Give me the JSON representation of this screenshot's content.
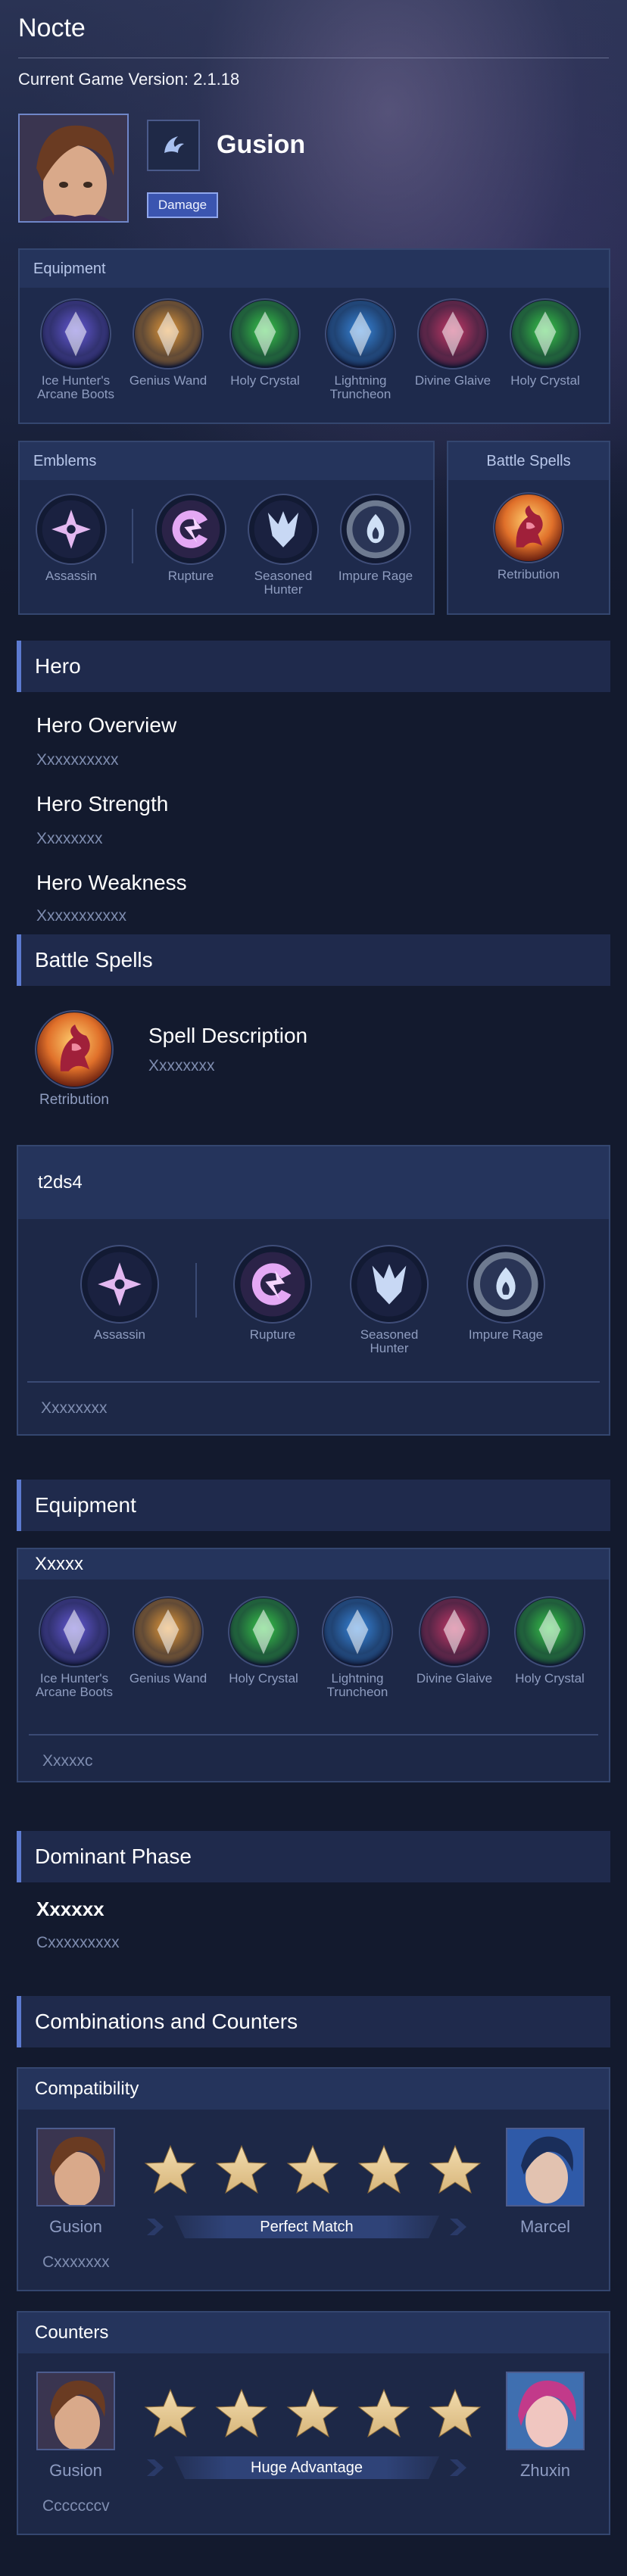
{
  "app": {
    "title": "Nocte",
    "version": "Current Game Version: 2.1.18"
  },
  "hero": {
    "name": "Gusion",
    "role": "Damage",
    "portrait_icon": "gusion-portrait",
    "role_icon": "assassin-role-icon"
  },
  "equipment_panel": {
    "title": "Equipment",
    "items": [
      {
        "label": "Ice Hunter's Arcane Boots",
        "icon": "boots-icon",
        "color": "#6a5de0"
      },
      {
        "label": "Genius Wand",
        "icon": "wand-icon",
        "color": "#f2a23a"
      },
      {
        "label": "Holy Crystal",
        "icon": "crystal-icon",
        "color": "#39d34a"
      },
      {
        "label": "Lightning Truncheon",
        "icon": "truncheon-icon",
        "color": "#3a8ee8"
      },
      {
        "label": "Divine Glaive",
        "icon": "glaive-icon",
        "color": "#d03a6a"
      },
      {
        "label": "Holy Crystal",
        "icon": "crystal-icon",
        "color": "#39d34a"
      }
    ]
  },
  "emblems_panel": {
    "title": "Emblems",
    "items": [
      {
        "label": "Assassin",
        "icon": "assassin-emblem-icon"
      },
      {
        "label": "Rupture",
        "icon": "rupture-icon"
      },
      {
        "label": "Seasoned Hunter",
        "icon": "seasoned-hunter-icon"
      },
      {
        "label": "Impure Rage",
        "icon": "impure-rage-icon"
      }
    ]
  },
  "battle_spells_panel": {
    "title": "Battle Spells",
    "spell": {
      "label": "Retribution",
      "icon": "retribution-icon"
    }
  },
  "hero_section": {
    "heading": "Hero",
    "overview_title": "Hero Overview",
    "overview_text": "Xxxxxxxxxx",
    "strength_title": "Hero Strength",
    "strength_text": "Xxxxxxxx",
    "weakness_title": "Hero Weakness",
    "weakness_text": "Xxxxxxxxxxx"
  },
  "battle_spells_section": {
    "heading": "Battle Spells",
    "spell_label": "Retribution",
    "desc_title": "Spell Description",
    "desc_text": "Xxxxxxxx"
  },
  "emblem_build": {
    "title": "t2ds4",
    "items": [
      {
        "label": "Assassin",
        "icon": "assassin-emblem-icon"
      },
      {
        "label": "Rupture",
        "icon": "rupture-icon"
      },
      {
        "label": "Seasoned Hunter",
        "icon": "seasoned-hunter-icon"
      },
      {
        "label": "Impure Rage",
        "icon": "impure-rage-icon"
      }
    ],
    "note": "Xxxxxxxx"
  },
  "equipment_section": {
    "heading": "Equipment",
    "build_title": "Xxxxx",
    "items": [
      {
        "label": "Ice Hunter's Arcane Boots"
      },
      {
        "label": "Genius Wand"
      },
      {
        "label": "Holy Crystal"
      },
      {
        "label": "Lightning Truncheon"
      },
      {
        "label": "Divine Glaive"
      },
      {
        "label": "Holy Crystal"
      }
    ],
    "note": "Xxxxxc"
  },
  "dominant_phase": {
    "heading": "Dominant Phase",
    "title": "Xxxxxx",
    "text": "Cxxxxxxxxx"
  },
  "combos": {
    "heading": "Combinations and Counters",
    "compatibility": {
      "title": "Compatibility",
      "left_name": "Gusion",
      "right_name": "Marcel",
      "rating": 5,
      "rating_label": "Perfect Match",
      "note": "Cxxxxxxx"
    },
    "counters": {
      "title": "Counters",
      "left_name": "Gusion",
      "right_name": "Zhuxin",
      "rating": 5,
      "rating_label": "Huge Advantage",
      "note": "Cccccccv"
    }
  },
  "colors": {
    "accent": "#5c7ad0",
    "panel": "#1e2a4c",
    "badge": "#3b55b0",
    "star": "#d7b57a"
  }
}
